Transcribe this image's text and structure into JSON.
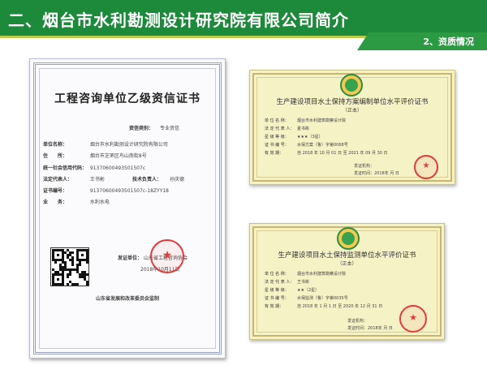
{
  "slide": {
    "title": "二、烟台市水利勘测设计研究院有限公司简介",
    "section_tab": "2、资质情况",
    "colors": {
      "header": "#1c8a3a",
      "stripe": "#b9c94a",
      "seal": "#e23b3b"
    }
  },
  "cert_left": {
    "title": "工程咨询单位乙级资信证书",
    "rows": [
      {
        "label": "资信类别：",
        "value": "专业资信"
      },
      {
        "label": "单位名称：",
        "value": "烟台市水利勘测设计研究院有限公司"
      },
      {
        "label": "住　　所：",
        "value": "烟台市芝罘区鸟山南街8号"
      },
      {
        "label": "统一社会信用代码：",
        "value": "91370600493501507c"
      },
      {
        "label": "法定代表人：",
        "value": "王书彬"
      },
      {
        "label": "技术负责人：",
        "value": "孙庆德"
      },
      {
        "label": "证书编号：",
        "value": "91370600493501507c-18ZYY18"
      },
      {
        "label": "业　　务：",
        "value": "水利水电"
      }
    ],
    "issuer_label": "发证单位：",
    "issuer_value": "山东省工程咨询协会",
    "issue_date": "2018年10月11日",
    "footer": "山东省发展和改革委员会监制"
  },
  "cert_top_right": {
    "title": "生产建设项目水土保持方案编制单位水平评价证书",
    "subtitle": "（正本）",
    "rows": [
      {
        "label": "单 位 名 称：",
        "value": "烟台市水利建筑勘察设计院"
      },
      {
        "label": "法 定 代 表 人：",
        "value": "夏书彬"
      },
      {
        "label": "星 级 等 级：",
        "value": "★★★（3星）"
      },
      {
        "label": "证 书 编 号：",
        "value": "水保方案（鲁）字第0068号"
      },
      {
        "label": "有 效 期：",
        "value": "自 2018 年 10 月 01 日 至 2021 年 09 月 30 日"
      }
    ],
    "issuer": "发证机构：",
    "issue_date": "发证时间：2018年 月 日"
  },
  "cert_bottom_right": {
    "title": "生产建设项目水土保持监测单位水平评价证书",
    "subtitle": "（正本）",
    "rows": [
      {
        "label": "单 位 名 称：",
        "value": "烟台市水利建筑勘察设计院"
      },
      {
        "label": "法 定 代 表 人：",
        "value": "王书彬"
      },
      {
        "label": "星 级 等 级：",
        "value": "★★（2星）"
      },
      {
        "label": "证 书 编 号：",
        "value": "水保监测（鲁）字第0035号"
      },
      {
        "label": "有 效 期：",
        "value": "自 2018 年 1 月 1 日 至 2020 年 12 月 31 日"
      }
    ],
    "issuer": "发证机构：",
    "issue_date": "发证时间：2018年 月 日"
  }
}
